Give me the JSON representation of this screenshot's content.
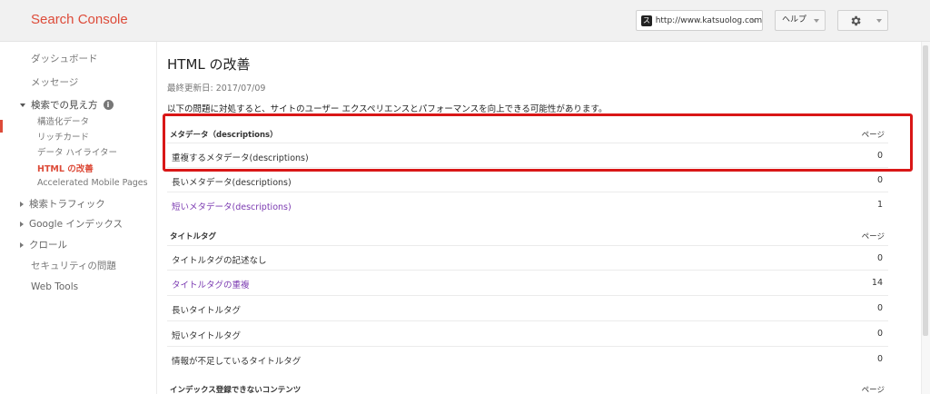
{
  "header": {
    "brand": "Search Console",
    "site_badge": "ス",
    "site_url": "http://www.katsuolog.com/",
    "help_label": "ヘルプ"
  },
  "sidebar": {
    "dashboard": "ダッシュボード",
    "messages": "メッセージ",
    "search_appearance": "検索での見え方",
    "info_glyph": "i",
    "structured_data": "構造化データ",
    "rich_cards": "リッチカード",
    "data_highlighter": "データ ハイライター",
    "html_improvements": "HTML の改善",
    "amp": "Accelerated Mobile Pages",
    "search_traffic": "検索トラフィック",
    "google_index": "Google インデックス",
    "crawl": "クロール",
    "security": "セキュリティの問題",
    "web_tools": "Web Tools"
  },
  "main": {
    "title": "HTML の改善",
    "updated": "最終更新日: 2017/07/09",
    "intro": "以下の問題に対処すると、サイトのユーザー エクスペリエンスとパフォーマンスを向上できる可能性があります。",
    "pages_col": "ページ",
    "meta_section": "メタデータ（descriptions）",
    "meta_rows": [
      {
        "label": "重複するメタデータ(descriptions)",
        "value": "0"
      },
      {
        "label": "長いメタデータ(descriptions)",
        "value": "0"
      },
      {
        "label": "短いメタデータ(descriptions)",
        "value": "1"
      }
    ],
    "title_section": "タイトルタグ",
    "title_rows": [
      {
        "label": "タイトルタグの記述なし",
        "value": "0"
      },
      {
        "label": "タイトルタグの重複",
        "value": "14"
      },
      {
        "label": "長いタイトルタグ",
        "value": "0"
      },
      {
        "label": "短いタイトルタグ",
        "value": "0"
      },
      {
        "label": "情報が不足しているタイトルタグ",
        "value": "0"
      }
    ],
    "index_section": "インデックス登録できないコンテンツ"
  },
  "colors": {
    "brand": "#dd4b39",
    "link": "#7b3ab1",
    "highlight": "#d91717"
  }
}
